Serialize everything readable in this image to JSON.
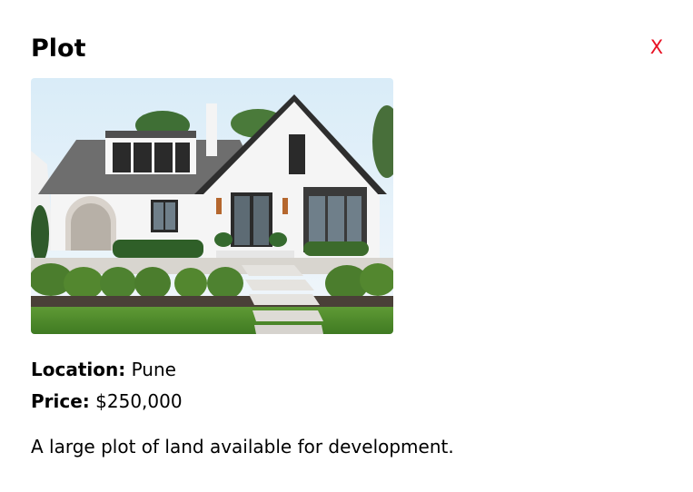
{
  "modal": {
    "title": "Plot",
    "close_label": "X",
    "close_color": "#e81123",
    "image_alt_subject": "white house with gabled roof and landscaped front garden"
  },
  "details": {
    "location_label": "Location:",
    "location_value": "Pune",
    "price_label": "Price:",
    "price_value": "$250,000"
  },
  "description": "A large plot of land available for development."
}
